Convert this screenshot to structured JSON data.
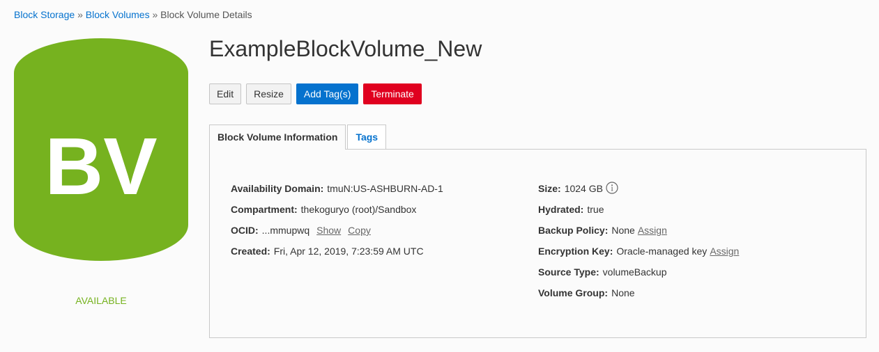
{
  "breadcrumb": {
    "items": [
      {
        "label": "Block Storage",
        "link": true
      },
      {
        "label": "Block Volumes",
        "link": true
      },
      {
        "label": "Block Volume Details",
        "link": false
      }
    ],
    "separator": "»"
  },
  "resource_icon": {
    "text": "BV",
    "color": "#76b21f",
    "icon": "cylinder-icon"
  },
  "status": {
    "label": "AVAILABLE",
    "color": "#76b21f"
  },
  "page_title": "ExampleBlockVolume_New",
  "actions": {
    "edit": "Edit",
    "resize": "Resize",
    "add_tags": "Add Tag(s)",
    "terminate": "Terminate"
  },
  "tabs": [
    {
      "label": "Block Volume Information",
      "active": true
    },
    {
      "label": "Tags",
      "active": false
    }
  ],
  "details": {
    "left": {
      "availability_domain": {
        "label": "Availability Domain:",
        "value": "tmuN:US-ASHBURN-AD-1"
      },
      "compartment": {
        "label": "Compartment:",
        "value": "thekoguryo (root)/Sandbox"
      },
      "ocid": {
        "label": "OCID:",
        "value": "...mmupwq",
        "show": "Show",
        "copy": "Copy"
      },
      "created": {
        "label": "Created:",
        "value": "Fri, Apr 12, 2019, 7:23:59 AM UTC"
      }
    },
    "right": {
      "size": {
        "label": "Size:",
        "value": "1024 GB",
        "icon": "info-icon"
      },
      "hydrated": {
        "label": "Hydrated:",
        "value": "true"
      },
      "backup_policy": {
        "label": "Backup Policy:",
        "value": "None",
        "link": "Assign"
      },
      "encryption_key": {
        "label": "Encryption Key:",
        "value": "Oracle-managed key",
        "link": "Assign"
      },
      "source_type": {
        "label": "Source Type:",
        "value": "volumeBackup"
      },
      "volume_group": {
        "label": "Volume Group:",
        "value": "None"
      }
    }
  },
  "colors": {
    "link": "#0572ce",
    "primary": "#0572ce",
    "danger": "#e0001f",
    "available": "#76b21f"
  }
}
